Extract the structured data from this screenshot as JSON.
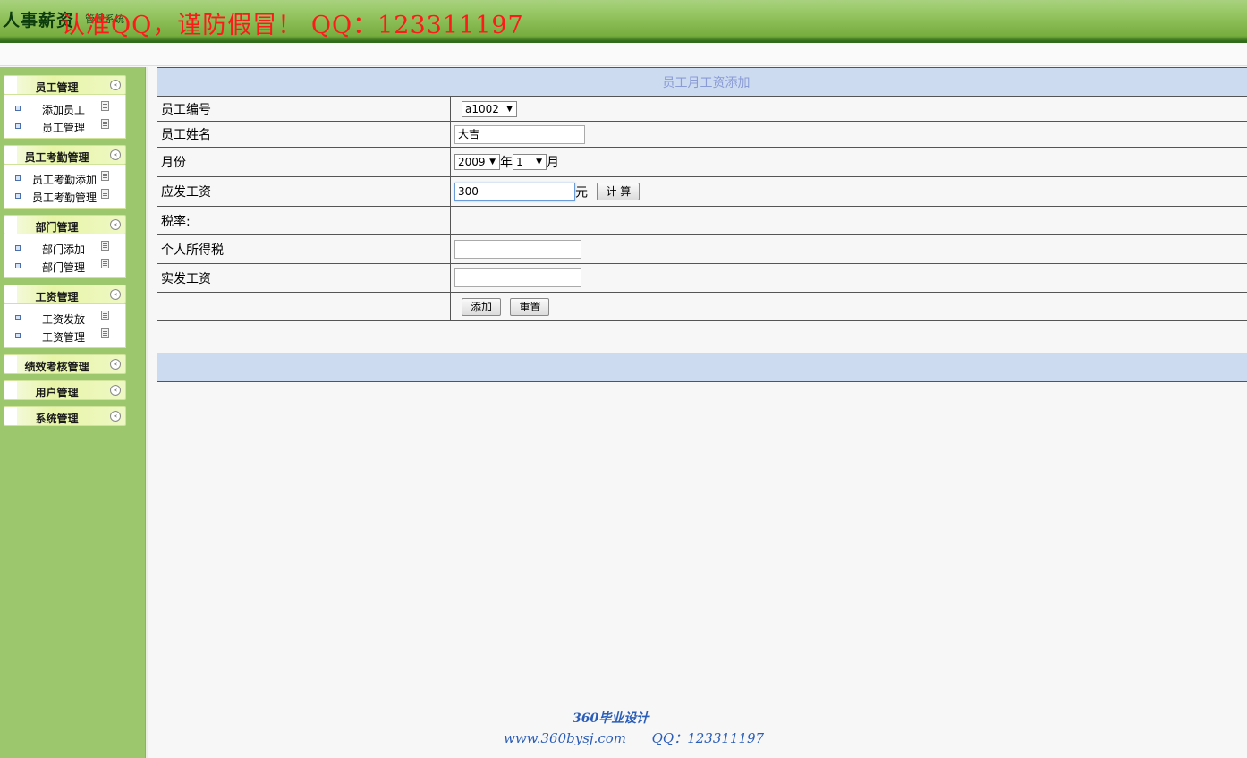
{
  "header": {
    "brand": "人事薪资",
    "brand_sub": "管理系统",
    "watermark": "认准QQ，谨防假冒！ QQ：123311197"
  },
  "sidebar": {
    "groups": [
      {
        "title": "员工管理",
        "items": [
          "添加员工",
          "员工管理"
        ]
      },
      {
        "title": "员工考勤管理",
        "items": [
          "员工考勤添加",
          "员工考勤管理"
        ]
      },
      {
        "title": "部门管理",
        "items": [
          "部门添加",
          "部门管理"
        ]
      },
      {
        "title": "工资管理",
        "items": [
          "工资发放",
          "工资管理"
        ]
      },
      {
        "title": "绩效考核管理",
        "items": []
      },
      {
        "title": "用户管理",
        "items": []
      },
      {
        "title": "系统管理",
        "items": []
      }
    ],
    "toggle_glyph": "«"
  },
  "form": {
    "title": "员工月工资添加",
    "rows": {
      "employee_id_label": "员工编号",
      "employee_id_value": "a1002",
      "employee_name_label": "员工姓名",
      "employee_name_value": "大吉",
      "month_label": "月份",
      "year_value": "2009",
      "year_unit": "年",
      "month_value": "1",
      "month_unit": "月",
      "gross_label": "应发工资",
      "gross_value": "300",
      "gross_unit": "元",
      "calc_button": "计 算",
      "tax_rate_label": "税率:",
      "income_tax_label": "个人所得税",
      "income_tax_value": "",
      "net_label": "实发工资",
      "net_value": "",
      "add_button": "添加",
      "reset_button": "重置"
    }
  },
  "credit": {
    "line1": "360毕业设计",
    "line2": "www.360bysj.com      QQ：123311197"
  },
  "colors": {
    "header_green": "#77ad3f",
    "sidebar_green": "#9dc76c",
    "form_title_bg": "#cddbf0",
    "form_title_text": "#8a9bd6",
    "watermark_red": "#ff1a1a",
    "credit_blue": "#2a5db8"
  }
}
